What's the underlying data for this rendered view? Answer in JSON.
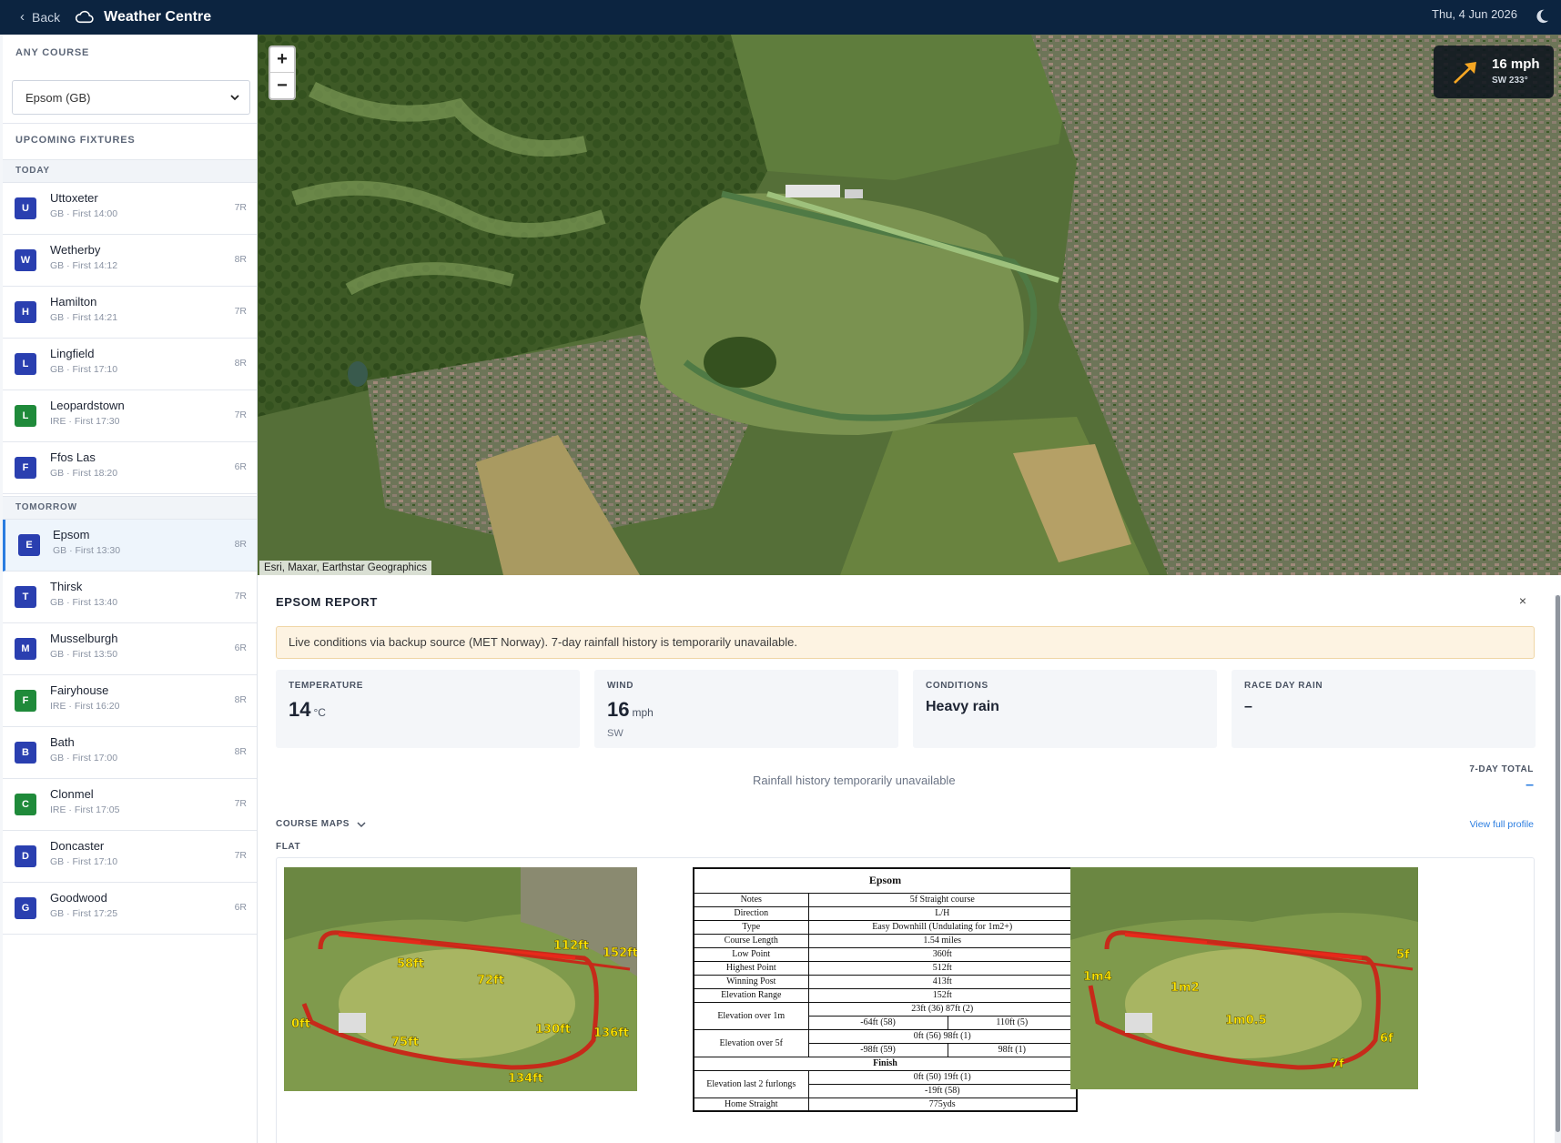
{
  "header": {
    "back_label": "Back",
    "app_title": "Weather Centre",
    "date": "Thu, 4 Jun 2026"
  },
  "sidebar": {
    "any_course_label": "ANY COURSE",
    "selected_course": "Epsom (GB)",
    "upcoming_label": "UPCOMING FIXTURES",
    "today_label": "TODAY",
    "tomorrow_label": "TOMORROW",
    "today": [
      {
        "letter": "U",
        "name": "Uttoxeter",
        "sub": "GB · First 14:00",
        "races": "7R",
        "color": "#2a3fb0"
      },
      {
        "letter": "W",
        "name": "Wetherby",
        "sub": "GB · First 14:12",
        "races": "8R",
        "color": "#2a3fb0"
      },
      {
        "letter": "H",
        "name": "Hamilton",
        "sub": "GB · First 14:21",
        "races": "7R",
        "color": "#2a3fb0"
      },
      {
        "letter": "L",
        "name": "Lingfield",
        "sub": "GB · First 17:10",
        "races": "8R",
        "color": "#2a3fb0"
      },
      {
        "letter": "L",
        "name": "Leopardstown",
        "sub": "IRE · First 17:30",
        "races": "7R",
        "color": "#1f8a3a"
      },
      {
        "letter": "F",
        "name": "Ffos Las",
        "sub": "GB · First 18:20",
        "races": "6R",
        "color": "#2a3fb0"
      }
    ],
    "tomorrow": [
      {
        "letter": "E",
        "name": "Epsom",
        "sub": "GB · First 13:30",
        "races": "8R",
        "color": "#2a3fb0",
        "selected": true
      },
      {
        "letter": "T",
        "name": "Thirsk",
        "sub": "GB · First 13:40",
        "races": "7R",
        "color": "#2a3fb0"
      },
      {
        "letter": "M",
        "name": "Musselburgh",
        "sub": "GB · First 13:50",
        "races": "6R",
        "color": "#2a3fb0"
      },
      {
        "letter": "F",
        "name": "Fairyhouse",
        "sub": "IRE · First 16:20",
        "races": "8R",
        "color": "#1f8a3a"
      },
      {
        "letter": "B",
        "name": "Bath",
        "sub": "GB · First 17:00",
        "races": "8R",
        "color": "#2a3fb0"
      },
      {
        "letter": "C",
        "name": "Clonmel",
        "sub": "IRE · First 17:05",
        "races": "7R",
        "color": "#1f8a3a"
      },
      {
        "letter": "D",
        "name": "Doncaster",
        "sub": "GB · First 17:10",
        "races": "7R",
        "color": "#2a3fb0"
      },
      {
        "letter": "G",
        "name": "Goodwood",
        "sub": "GB · First 17:25",
        "races": "6R",
        "color": "#2a3fb0"
      }
    ]
  },
  "map": {
    "zoom_in": "+",
    "zoom_out": "−",
    "wind_speed": "16 mph",
    "wind_dir": "SW 233°",
    "attribution": "Esri, Maxar, Earthstar Geographics"
  },
  "report": {
    "title": "EPSOM REPORT",
    "close": "×",
    "notice": "Live conditions via backup source (MET Norway). 7-day rainfall history is temporarily unavailable.",
    "temperature": {
      "label": "TEMPERATURE",
      "value": "14",
      "unit": "°C"
    },
    "wind": {
      "label": "WIND",
      "value": "16",
      "unit": "mph",
      "dir": "SW"
    },
    "conditions": {
      "label": "CONDITIONS",
      "value": "Heavy rain"
    },
    "race_day_rain": {
      "label": "RACE DAY RAIN",
      "value": "–"
    },
    "rain_unavailable": "Rainfall history temporarily unavailable",
    "seven_day_label": "7-DAY TOTAL",
    "seven_day_value": "–",
    "course_maps_label": "COURSE MAPS",
    "view_profile": "View full profile",
    "flat_label": "FLAT"
  },
  "elevation_table": {
    "title": "Epsom",
    "rows": [
      [
        "Notes",
        "5f Straight course"
      ],
      [
        "Direction",
        "L/H"
      ],
      [
        "Type",
        "Easy Downhill  (Undulating for 1m2+)"
      ],
      [
        "Course Length",
        "1.54 miles"
      ],
      [
        "Low Point",
        "360ft"
      ],
      [
        "Highest Point",
        "512ft"
      ],
      [
        "Winning Post",
        "413ft"
      ],
      [
        "Elevation Range",
        "152ft"
      ]
    ],
    "over_1m": {
      "label": "Elevation over 1m",
      "top": "23ft (36)  87ft (2)",
      "left": "-64ft (58)",
      "right": "110ft  (5)"
    },
    "over_5f": {
      "label": "Elevation over 5f",
      "top": "0ft (56)  98ft (1)",
      "left": "-98ft (59)",
      "right": "98ft  (1)"
    },
    "finish": "Finish",
    "last_2f": {
      "label": "Elevation last 2 furlongs",
      "top": "0ft (50)  19ft (1)",
      "bottom": "-19ft (58)"
    },
    "home_straight": [
      "Home Straight",
      "775yds"
    ]
  },
  "course_map_left_labels": [
    "58ft",
    "72ft",
    "112ft",
    "152ft",
    "0ft",
    "75ft",
    "130ft",
    "136ft",
    "134ft"
  ],
  "course_map_right_labels": [
    "5f",
    "1m4",
    "1m2",
    "1m0.5",
    "6f",
    "7f"
  ]
}
